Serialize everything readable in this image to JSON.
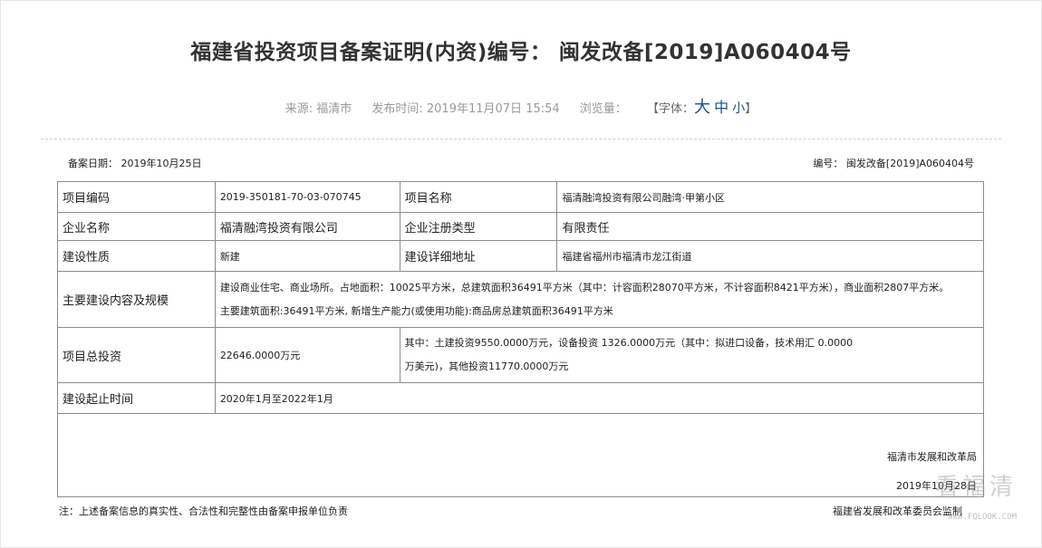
{
  "page": {
    "title": "福建省投资项目备案证明(内资)编号： 闽发改备[2019]A060404号",
    "source": "来源: 福清市",
    "publish_time": "发布时间: 2019年11月07日 15:54",
    "views": "浏览量：",
    "font_label": "【字体：",
    "font_big": "大",
    "font_mid": "中",
    "font_small": "小",
    "font_close": "】"
  },
  "record": {
    "date": "备案日期： 2019年10月25日",
    "number": "编号： 闽发改备[2019]A060404号"
  },
  "table": {
    "project_code_label": "项目编码",
    "project_code_value": "2019-350181-70-03-070745",
    "project_name_label": "项目名称",
    "project_name_value": "福清融湾投资有限公司融湾·甲第小区",
    "company_label": "企业名称",
    "company_value": "福清融湾投资有限公司",
    "reg_type_label": "企业注册类型",
    "reg_type_value": "有限责任",
    "nature_label": "建设性质",
    "nature_value": "新建",
    "address_label": "建设详细地址",
    "address_value": "福建省福州市福清市龙江街道",
    "content_label": "主要建设内容及规模",
    "content_line1": "建设商业住宅、商业场所。占地面积：10025平方米，总建筑面积36491平方米（其中：计容面积28070平方米，不计容面积8421平方米），商业面积2807平方米。",
    "content_line2": "主要建筑面积:36491平方米, 新增生产能力(或使用功能):商品房总建筑面积36491平方米",
    "investment_label": "项目总投资",
    "investment_value": "22646.0000万元",
    "investment_detail_line1": "其中：土建投资9550.0000万元，设备投资 1326.0000万元（其中：拟进口设备，技术用汇 0.0000",
    "investment_detail_line2": "万美元)，其他投资11770.0000万元",
    "period_label": "建设起止时间",
    "period_value": "2020年1月至2022年1月"
  },
  "signature": {
    "org": "福清市发展和改革局",
    "date": "2019年10月28日"
  },
  "footer": {
    "note": "注：上述备案信息的真实性、合法性和完整性由备案申报单位负责",
    "org": "福建省发展和改革委员会监制"
  },
  "watermark": {
    "text": "看福清",
    "url": "WWW.FQLOOK.COM"
  }
}
